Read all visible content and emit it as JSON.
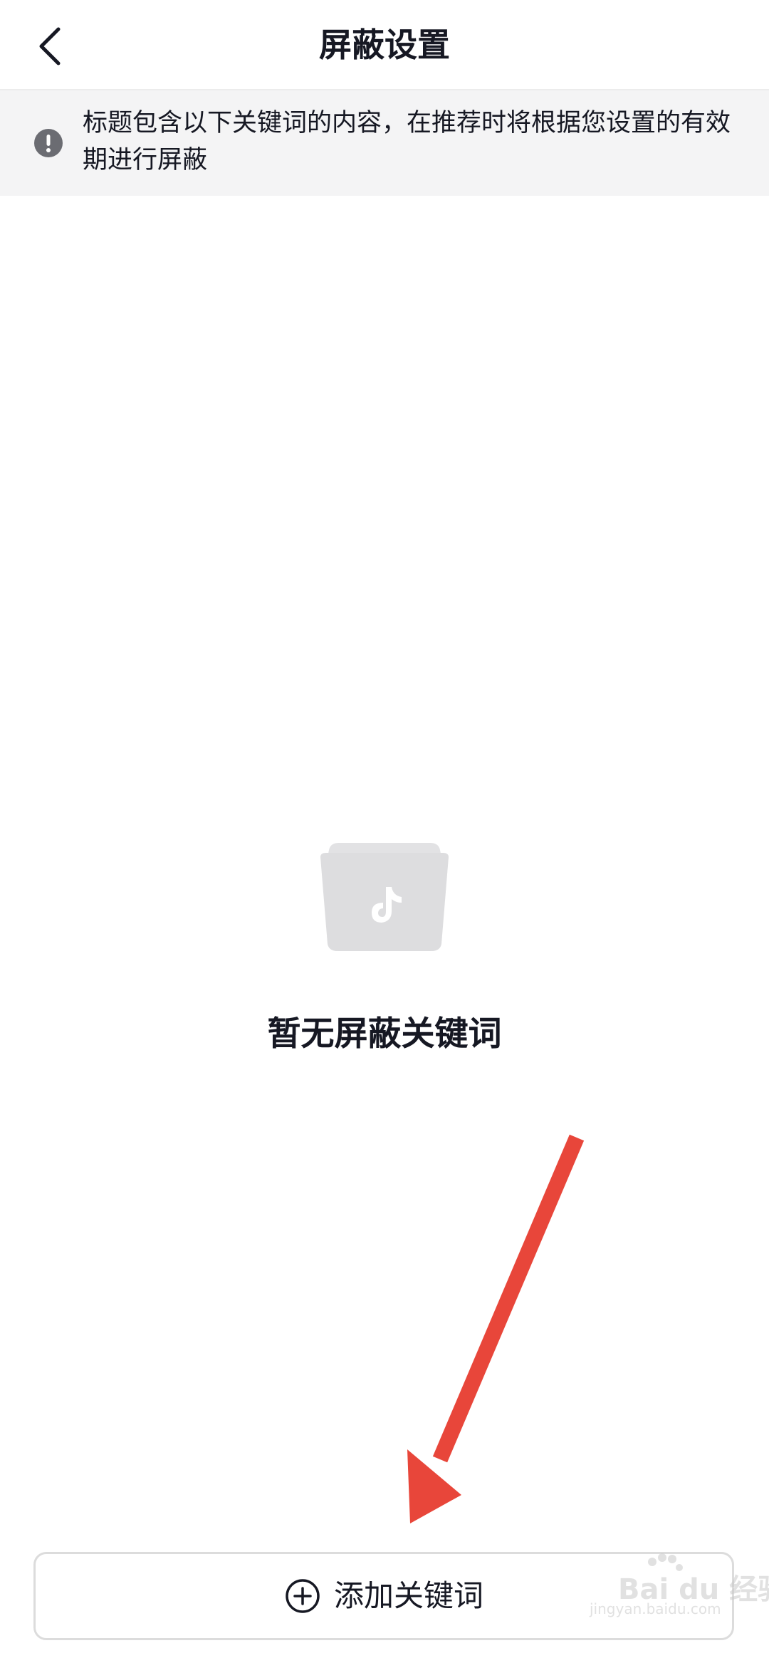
{
  "header": {
    "title": "屏蔽设置",
    "back_icon": "chevron-left-icon"
  },
  "notice": {
    "icon": "exclamation-circle-icon",
    "text": "标题包含以下关键词的内容，在推荐时将根据您设置的有效期进行屏蔽"
  },
  "empty_state": {
    "icon": "empty-folder-music-icon",
    "title": "暂无屏蔽关键词"
  },
  "footer": {
    "add_button_label": "添加关键词",
    "add_icon": "plus-circle-icon"
  },
  "watermark": {
    "main": "Bai du 经验",
    "sub": "jingyan.baidu.com"
  },
  "colors": {
    "annotation_arrow": "#e8463a",
    "notice_background": "#f4f4f5",
    "text_primary": "#161823",
    "placeholder_gray": "#dcdcdc"
  }
}
